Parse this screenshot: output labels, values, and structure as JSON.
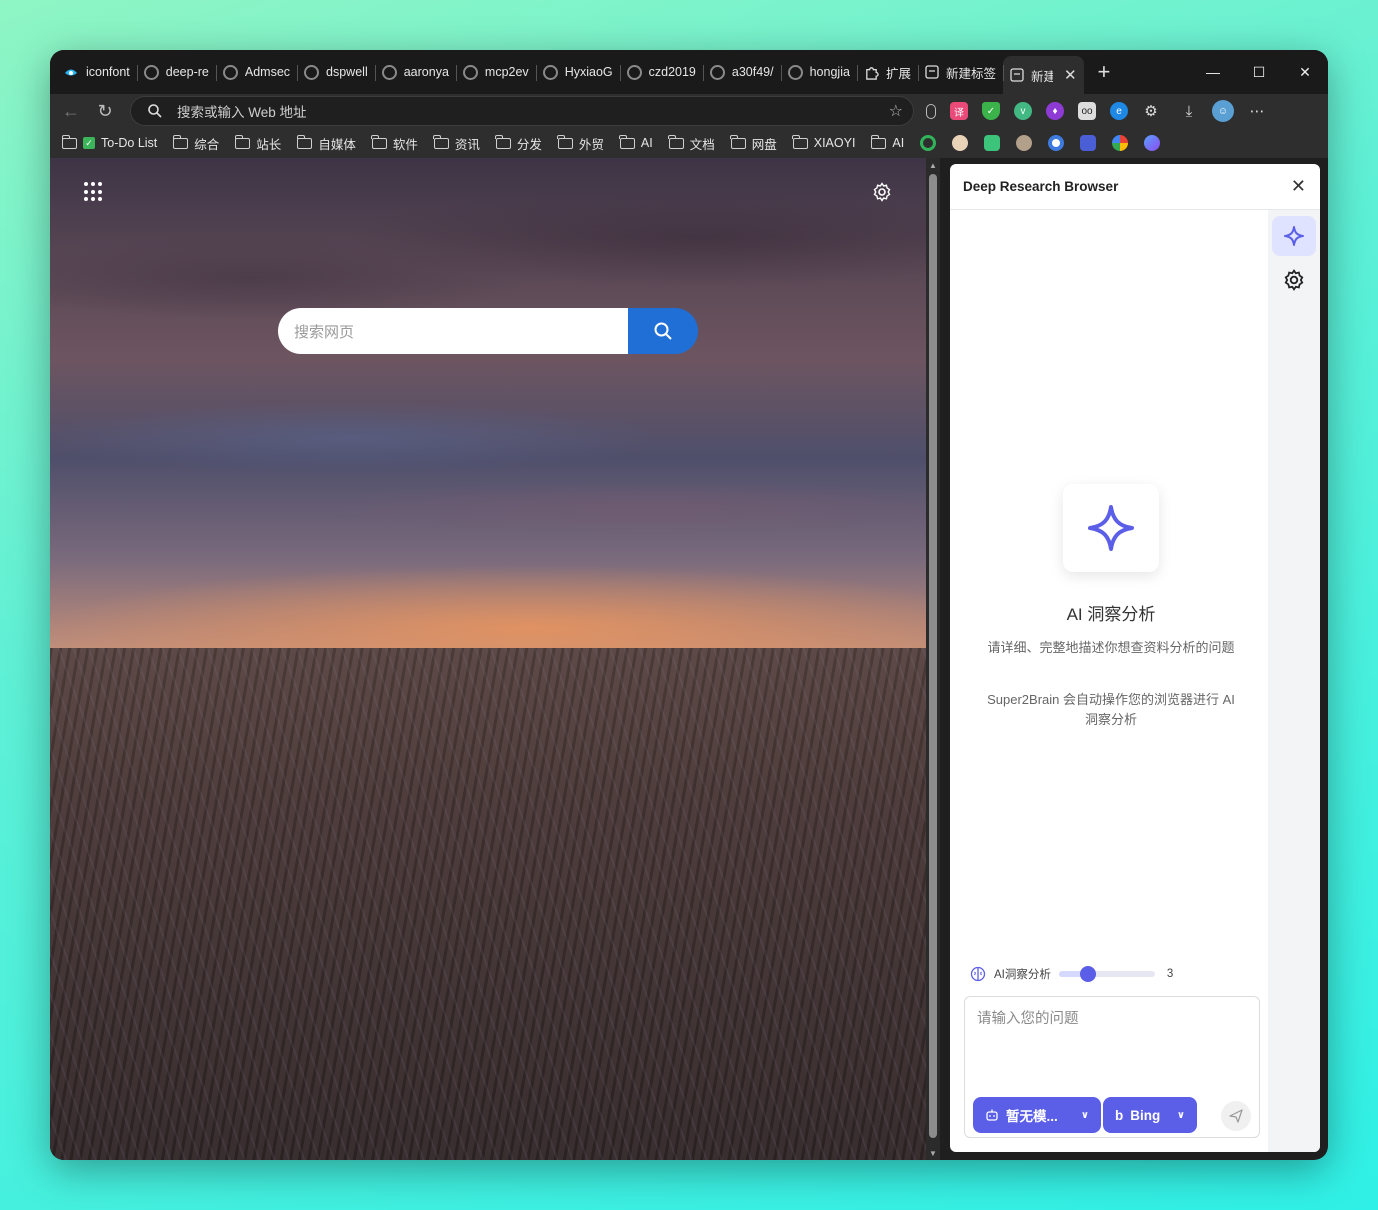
{
  "tabs": [
    {
      "label": "iconfont",
      "icon": "iconfont-icon"
    },
    {
      "label": "deep-re",
      "icon": "github-icon"
    },
    {
      "label": "Admsec",
      "icon": "github-icon"
    },
    {
      "label": "dspwell",
      "icon": "github-icon"
    },
    {
      "label": "aaronya",
      "icon": "github-icon"
    },
    {
      "label": "mcp2ev",
      "icon": "github-icon"
    },
    {
      "label": "HyxiaoG",
      "icon": "github-icon"
    },
    {
      "label": "czd2019",
      "icon": "github-icon"
    },
    {
      "label": "a30f49/",
      "icon": "github-icon"
    },
    {
      "label": "hongjia",
      "icon": "github-icon"
    },
    {
      "label": "扩展",
      "icon": "extension-icon"
    },
    {
      "label": "新建标签",
      "icon": "newtab-icon"
    },
    {
      "label": "新建",
      "icon": "newtab-icon",
      "active": true
    }
  ],
  "toolbar": {
    "address_placeholder": "搜索或输入 Web 地址"
  },
  "bookmarks": [
    {
      "label": "To-Do List",
      "type": "check"
    },
    {
      "label": "综合"
    },
    {
      "label": "站长"
    },
    {
      "label": "自媒体"
    },
    {
      "label": "软件"
    },
    {
      "label": "资讯"
    },
    {
      "label": "分发"
    },
    {
      "label": "外贸"
    },
    {
      "label": "AI"
    },
    {
      "label": "文档"
    },
    {
      "label": "网盘"
    },
    {
      "label": "XIAOYI"
    },
    {
      "label": "AI"
    }
  ],
  "newtab": {
    "search_placeholder": "搜索网页"
  },
  "panel": {
    "title": "Deep Research Browser",
    "ai_title": "AI 洞察分析",
    "ai_desc": "请详细、完整地描述你想查资料分析的问题",
    "ai_desc2": "Super2Brain 会自动操作您的浏览器进行 AI 洞察分析",
    "depth_label": "AI洞察分析",
    "depth_value": "3",
    "depth_fraction": 0.3,
    "input_placeholder": "请输入您的问题",
    "model_button": "暂无模...",
    "engine_button": "Bing"
  },
  "colors": {
    "accent": "#5b5ee6",
    "search_button": "#1f6fd6"
  }
}
